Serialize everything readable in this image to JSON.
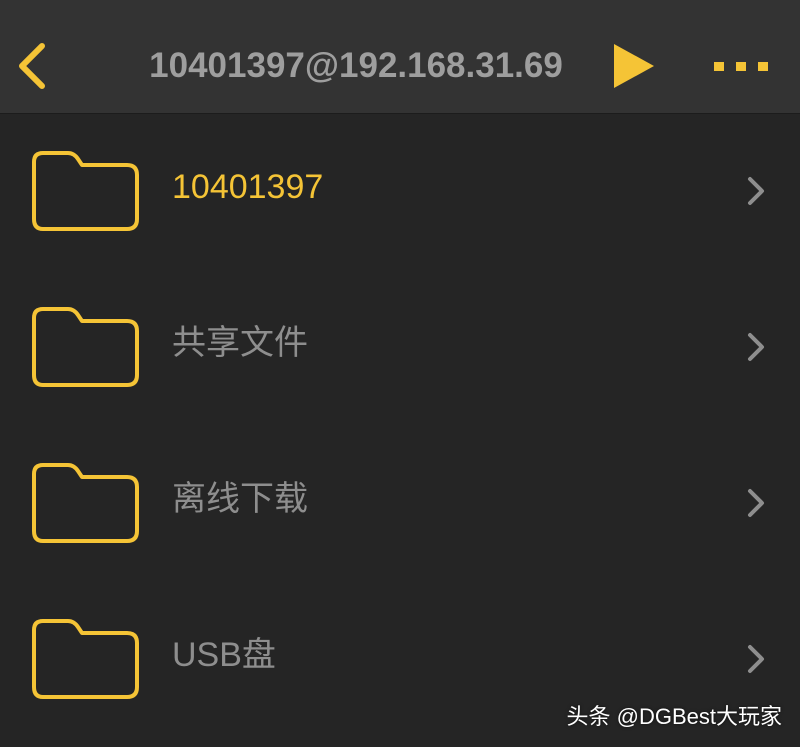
{
  "nav": {
    "title": "10401397@192.168.31.69",
    "back_icon": "chevron-left-icon",
    "play_icon": "play-icon",
    "more_icon": "more-dots-icon"
  },
  "colors": {
    "accent": "#f5c436",
    "nav_background": "#333333",
    "background": "#252525",
    "label": "#8e8e8e",
    "title": "#9e9e9e",
    "chevron": "#8e8e8e"
  },
  "folders": [
    {
      "label": "10401397",
      "icon": "folder-icon",
      "active": true
    },
    {
      "label": "共享文件",
      "icon": "folder-icon",
      "active": false
    },
    {
      "label": "离线下载",
      "icon": "folder-icon",
      "active": false
    },
    {
      "label": "USB盘",
      "icon": "folder-icon",
      "active": false
    }
  ],
  "watermark": "头条 @DGBest大玩家"
}
